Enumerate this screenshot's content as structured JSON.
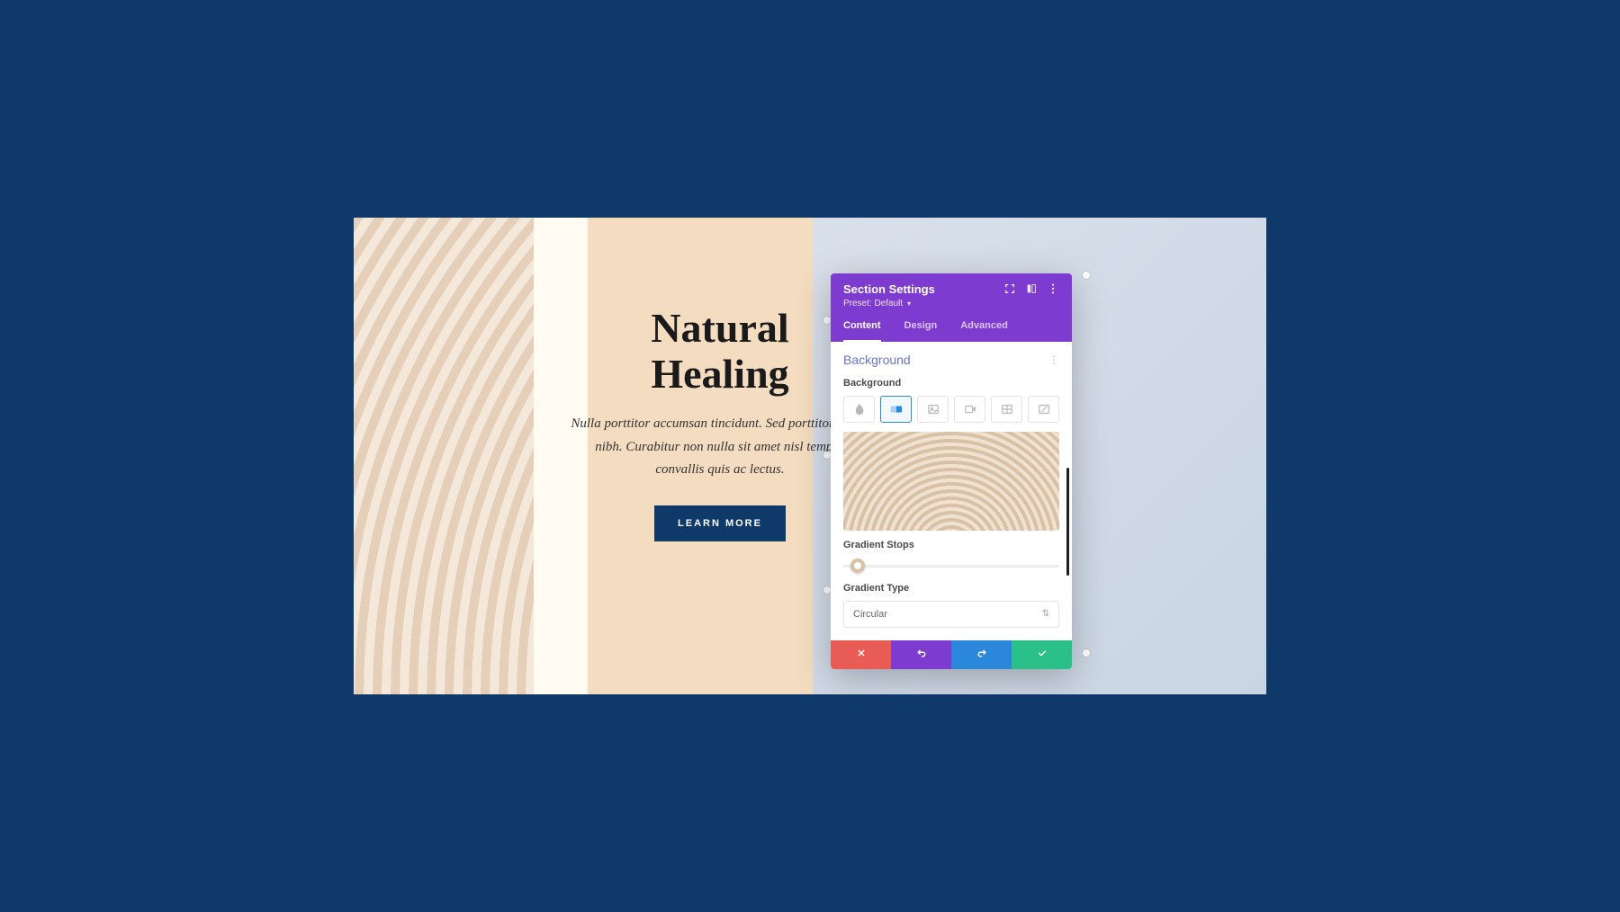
{
  "hero": {
    "title_line1": "Natural",
    "title_line2": "Healing",
    "body": "Nulla porttitor accumsan tincidunt. Sed porttitor lectus nibh. Curabitur non nulla sit amet nisl tempus convallis quis ac lectus.",
    "cta": "LEARN MORE"
  },
  "modal": {
    "title": "Section Settings",
    "preset_label": "Preset: Default",
    "tabs": {
      "content": "Content",
      "design": "Design",
      "advanced": "Advanced"
    },
    "section_heading": "Background",
    "fields": {
      "background_label": "Background",
      "gradient_stops_label": "Gradient Stops",
      "gradient_type_label": "Gradient Type",
      "gradient_type_value": "Circular"
    },
    "bg_types": [
      "color",
      "gradient",
      "image",
      "video",
      "pattern",
      "mask"
    ]
  },
  "colors": {
    "page_bg": "#0e3968",
    "purple": "#7e3bd0",
    "blue": "#2b87da",
    "green": "#2bbf8a",
    "red": "#e85c55"
  }
}
